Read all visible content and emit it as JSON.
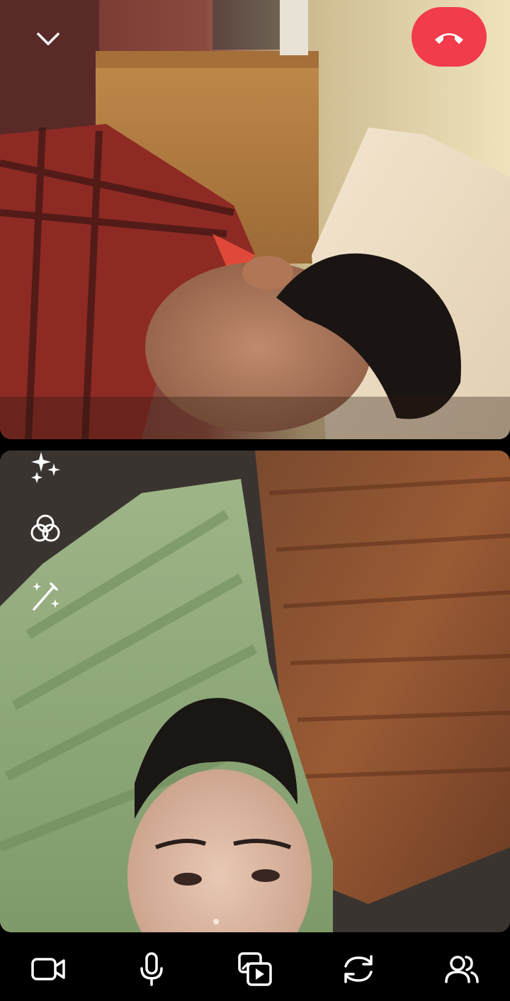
{
  "call": {
    "status": "active",
    "accent_end_call": "#f23b4b",
    "icon_color": "#ffffff"
  },
  "top_controls": {
    "collapse_icon": "chevron-down-icon",
    "end_call_icon": "phone-hangup-icon"
  },
  "remote_feed": {
    "description_icon": "remote-video-feed"
  },
  "self_feed": {
    "effects": [
      {
        "icon": "sparkles-icon"
      },
      {
        "icon": "filters-icon"
      },
      {
        "icon": "magic-wand-icon"
      }
    ]
  },
  "bottom_bar": {
    "buttons": [
      {
        "icon": "video-camera-icon"
      },
      {
        "icon": "microphone-icon"
      },
      {
        "icon": "media-share-icon"
      },
      {
        "icon": "flip-camera-icon"
      },
      {
        "icon": "participants-icon"
      }
    ]
  }
}
